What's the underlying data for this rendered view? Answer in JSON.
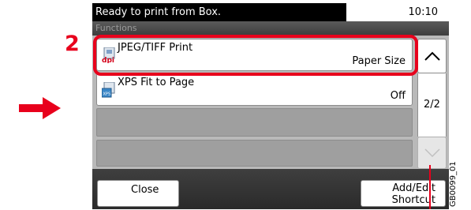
{
  "status_bar": {
    "message": "Ready to print from Box.",
    "time": "10:10"
  },
  "header": {
    "title": "Functions"
  },
  "rows": [
    {
      "label": "JPEG/TIFF Print",
      "value": "Paper Size",
      "icon": "jpeg-dpi-icon"
    },
    {
      "label": "XPS Fit to Page",
      "value": "Off",
      "icon": "xps-icon"
    }
  ],
  "scroll": {
    "page_indicator": "2/2",
    "up_icon": "chevron-up-icon",
    "down_icon": "chevron-down-icon"
  },
  "bottom": {
    "close_label": "Close",
    "shortcut_label_line1": "Add/Edit",
    "shortcut_label_line2": "Shortcut"
  },
  "annotations": {
    "step_number": "2",
    "figure_id": "GB0099_01",
    "arrow_icon": "right-arrow-icon"
  },
  "colors": {
    "highlight": "#e8001c",
    "status_bg": "#000000",
    "panel_bg": "#b9b9b9"
  }
}
